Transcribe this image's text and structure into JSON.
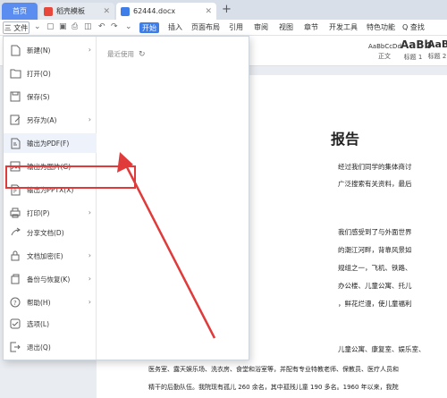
{
  "tabs": {
    "home": "首页",
    "template": "稻壳模板",
    "doc_name": "62444.docx"
  },
  "menubar": {
    "file_label": "三 文件",
    "start": "开始",
    "items": [
      "插入",
      "页面布局",
      "引用",
      "审阅",
      "视图",
      "章节",
      "开发工具",
      "特色功能"
    ],
    "search": "Q 查找"
  },
  "ribbon": {
    "styles": [
      {
        "preview": "AaBbCcDd",
        "name": "正文"
      },
      {
        "preview": "AaBb",
        "name": "标题 1"
      },
      {
        "preview": "AaBb",
        "name": "标题 2"
      }
    ]
  },
  "file_menu": {
    "items": [
      {
        "label": "新建(N)",
        "icon": "new-doc-icon",
        "submenu": true
      },
      {
        "label": "打开(O)",
        "icon": "open-folder-icon",
        "submenu": false
      },
      {
        "label": "保存(S)",
        "icon": "save-icon",
        "submenu": false
      },
      {
        "label": "另存为(A)",
        "icon": "save-as-icon",
        "submenu": true
      },
      {
        "label": "输出为PDF(F)",
        "icon": "export-pdf-icon",
        "submenu": false
      },
      {
        "label": "输出为图片(G)",
        "icon": "export-image-icon",
        "submenu": false
      },
      {
        "label": "输出为PPTX(X)",
        "icon": "export-pptx-icon",
        "submenu": false
      },
      {
        "label": "打印(P)",
        "icon": "print-icon",
        "submenu": true
      },
      {
        "label": "分享文档(D)",
        "icon": "share-icon",
        "submenu": false
      },
      {
        "label": "文档加密(E)",
        "icon": "encrypt-icon",
        "submenu": true
      },
      {
        "label": "备份与恢复(K)",
        "icon": "backup-icon",
        "submenu": true
      },
      {
        "label": "帮助(H)",
        "icon": "help-icon",
        "submenu": true
      },
      {
        "label": "选项(L)",
        "icon": "options-icon",
        "submenu": false
      },
      {
        "label": "退出(Q)",
        "icon": "exit-icon",
        "submenu": false
      }
    ],
    "recent_label": "最近使用"
  },
  "document": {
    "title": "报告",
    "lines": [
      "经过我们同学的集体商讨",
      "广泛搜索有关资料，最后",
      "我们感受到了与外面世界",
      "的潮江河畔，背靠风景如",
      "规组之一，飞机、铁路、",
      "办公楼、儿童公寓、托儿",
      "，鲜花烂漫，使儿童福利",
      "儿童公寓、康复室、娱乐室、",
      "医务室、露天娱乐场、洗衣房、食堂和浴室等，并配有专业特教老师、保教员、医疗人员和",
      "精干的后勤队伍。我院现有孤儿 260 余名，其中孤残儿童 190 多名。1960 年以来，我院"
    ]
  },
  "colors": {
    "accent": "#3f7ee8",
    "highlight_box": "#e03a3a"
  }
}
